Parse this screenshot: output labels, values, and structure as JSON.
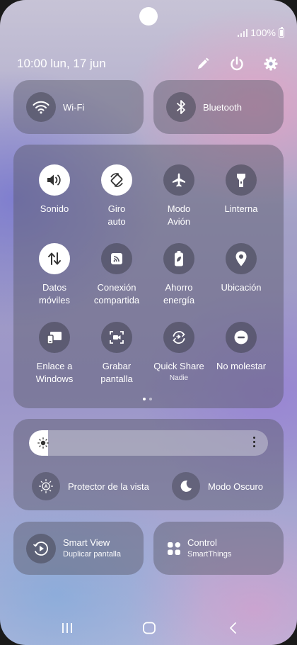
{
  "status": {
    "battery_text": "100%"
  },
  "header": {
    "datetime": "10:00  lun, 17 jun"
  },
  "top_tiles": [
    {
      "label": "Wi-Fi",
      "icon": "wifi-icon"
    },
    {
      "label": "Bluetooth",
      "icon": "bluetooth-icon"
    }
  ],
  "grid": [
    {
      "label": "Sonido",
      "icon": "volume-icon",
      "active": true
    },
    {
      "label": "Giro\nauto",
      "icon": "auto-rotate-icon",
      "active": true
    },
    {
      "label": "Modo\nAvión",
      "icon": "airplane-icon",
      "active": false
    },
    {
      "label": "Linterna",
      "icon": "flashlight-icon",
      "active": false
    },
    {
      "label": "Datos\nmóviles",
      "icon": "mobile-data-icon",
      "active": true
    },
    {
      "label": "Conexión\ncompartida",
      "icon": "hotspot-icon",
      "active": false
    },
    {
      "label": "Ahorro\nenergía",
      "icon": "power-saving-icon",
      "active": false
    },
    {
      "label": "Ubicación",
      "icon": "location-icon",
      "active": false
    },
    {
      "label": "Enlace a\nWindows",
      "icon": "link-windows-icon",
      "active": false
    },
    {
      "label": "Grabar\npantalla",
      "icon": "screen-record-icon",
      "active": false
    },
    {
      "label": "Quick Share",
      "sub": "Nadie",
      "icon": "quick-share-icon",
      "active": false
    },
    {
      "label": "No molestar",
      "icon": "do-not-disturb-icon",
      "active": false
    }
  ],
  "brightness": {
    "level_percent": 8
  },
  "display_options": [
    {
      "label": "Protector de la vista",
      "icon": "eye-comfort-icon"
    },
    {
      "label": "Modo Oscuro",
      "icon": "moon-icon"
    }
  ],
  "bottom_tiles": [
    {
      "label": "Smart View",
      "sub": "Duplicar pantalla",
      "icon": "smart-view-icon"
    },
    {
      "label": "Control",
      "sub": "SmartThings",
      "icon": "smartthings-icon"
    }
  ]
}
